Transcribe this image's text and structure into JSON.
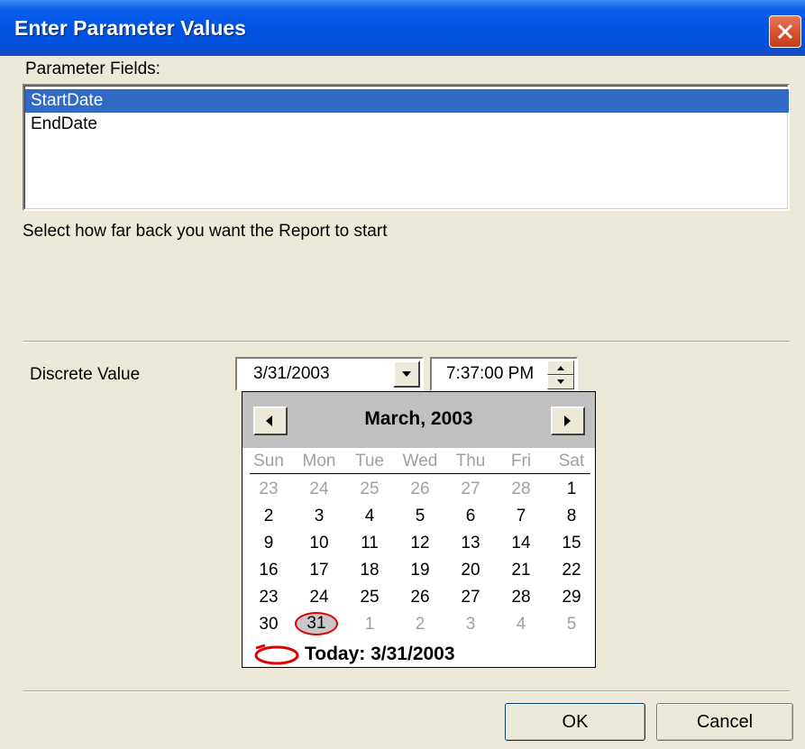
{
  "window": {
    "title": "Enter Parameter Values"
  },
  "parameters": {
    "label": "Parameter Fields:",
    "items": [
      "StartDate",
      "EndDate"
    ],
    "selected": "StartDate",
    "description": "Select how far back you want the Report to start"
  },
  "value": {
    "label": "Discrete Value",
    "date": "3/31/2003",
    "time": "7:37:00 PM"
  },
  "calendar": {
    "month_label": "March, 2003",
    "weekdays": [
      "Sun",
      "Mon",
      "Tue",
      "Wed",
      "Thu",
      "Fri",
      "Sat"
    ],
    "weeks": [
      [
        "23",
        "24",
        "25",
        "26",
        "27",
        "28",
        "1"
      ],
      [
        "2",
        "3",
        "4",
        "5",
        "6",
        "7",
        "8"
      ],
      [
        "9",
        "10",
        "11",
        "12",
        "13",
        "14",
        "15"
      ],
      [
        "16",
        "17",
        "18",
        "19",
        "20",
        "21",
        "22"
      ],
      [
        "23",
        "24",
        "25",
        "26",
        "27",
        "28",
        "29"
      ],
      [
        "30",
        "31",
        "1",
        "2",
        "3",
        "4",
        "5"
      ]
    ],
    "selected_day": "31",
    "today_label": "Today: 3/31/2003"
  },
  "buttons": {
    "ok": "OK",
    "cancel": "Cancel"
  },
  "colors": {
    "titlebar": "#0054e3",
    "selection": "#316ac5",
    "annotation": "#e00000"
  }
}
